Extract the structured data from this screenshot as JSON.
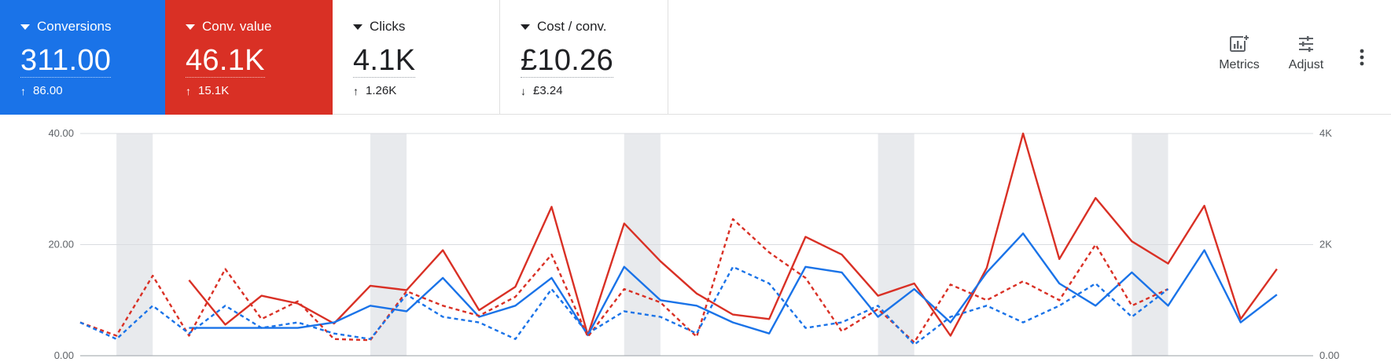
{
  "metrics": [
    {
      "label": "Conversions",
      "value": "311.00",
      "delta_dir": "up",
      "delta": "86.00",
      "bg": "#1a73e8"
    },
    {
      "label": "Conv. value",
      "value": "46.1K",
      "delta_dir": "up",
      "delta": "15.1K",
      "bg": "#d93025"
    },
    {
      "label": "Clicks",
      "value": "4.1K",
      "delta_dir": "up",
      "delta": "1.26K"
    },
    {
      "label": "Cost / conv.",
      "value": "£10.26",
      "delta_dir": "down",
      "delta": "£3.24"
    }
  ],
  "toolbar": {
    "metrics_label": "Metrics",
    "adjust_label": "Adjust",
    "more_icon": "more-vert-icon"
  },
  "chart_data": {
    "type": "line",
    "x": [
      1,
      2,
      3,
      4,
      5,
      6,
      7,
      8,
      9,
      10,
      11,
      12,
      13,
      14,
      15,
      16,
      17,
      18,
      19,
      20,
      21,
      22,
      23,
      24,
      25,
      26,
      27,
      28,
      29,
      30,
      31,
      32,
      33,
      34,
      35
    ],
    "left_axis": {
      "ticks": [
        "0.00",
        "20.00",
        "40.00"
      ],
      "range": [
        0,
        40
      ]
    },
    "right_axis": {
      "ticks": [
        "0.00",
        "2K",
        "4K"
      ],
      "range": [
        0,
        4000
      ]
    },
    "weekend_bands": [
      [
        2,
        3
      ],
      [
        9,
        10
      ],
      [
        16,
        17
      ],
      [
        23,
        24
      ],
      [
        30,
        31
      ]
    ],
    "series": [
      {
        "color": "#d93025",
        "dashed": false,
        "axis": "left",
        "values": [
          null,
          null,
          null,
          13.6,
          5.6,
          10.8,
          9.4,
          5.8,
          12.6,
          11.8,
          19.0,
          8.2,
          12.4,
          26.8,
          3.7,
          23.8,
          17.0,
          11.2,
          7.4,
          6.6,
          21.4,
          18.2,
          10.8,
          13.0,
          3.6,
          15.8,
          40.0,
          17.4,
          28.4,
          20.6,
          16.6,
          27.0,
          6.6,
          15.6
        ]
      },
      {
        "color": "#1a73e8",
        "dashed": false,
        "axis": "left",
        "values": [
          null,
          null,
          null,
          5.0,
          5.0,
          5.0,
          5.0,
          6.0,
          9.0,
          8.0,
          14.0,
          7.0,
          9.0,
          14.0,
          3.7,
          16.0,
          10.0,
          9.0,
          6.0,
          4.0,
          16.0,
          15.0,
          7.0,
          12.0,
          6.0,
          15.0,
          22.0,
          13.0,
          9.0,
          15.0,
          9.0,
          19.0,
          6.0,
          11.0
        ]
      },
      {
        "color": "#d93025",
        "dashed": true,
        "axis": "left",
        "values": [
          6.0,
          3.6,
          14.4,
          3.6,
          15.6,
          6.6,
          9.8,
          3.0,
          2.8,
          11.6,
          9.0,
          7.2,
          10.6,
          18.2,
          3.4,
          12.0,
          9.6,
          3.4,
          24.6,
          18.6,
          14.0,
          4.4,
          8.4,
          2.4,
          12.8,
          10.0,
          13.4,
          10.0,
          20.0,
          9.0,
          12.0
        ]
      },
      {
        "color": "#1a73e8",
        "dashed": true,
        "axis": "left",
        "values": [
          6.0,
          3.0,
          9.0,
          4.0,
          9.0,
          5.0,
          6.0,
          4.0,
          3.0,
          11.0,
          7.0,
          6.0,
          3.0,
          12.0,
          4.0,
          8.0,
          7.0,
          4.0,
          16.0,
          13.0,
          5.0,
          6.0,
          9.0,
          2.0,
          7.0,
          9.0,
          6.0,
          9.0,
          13.0,
          7.0,
          12.0
        ]
      }
    ]
  }
}
